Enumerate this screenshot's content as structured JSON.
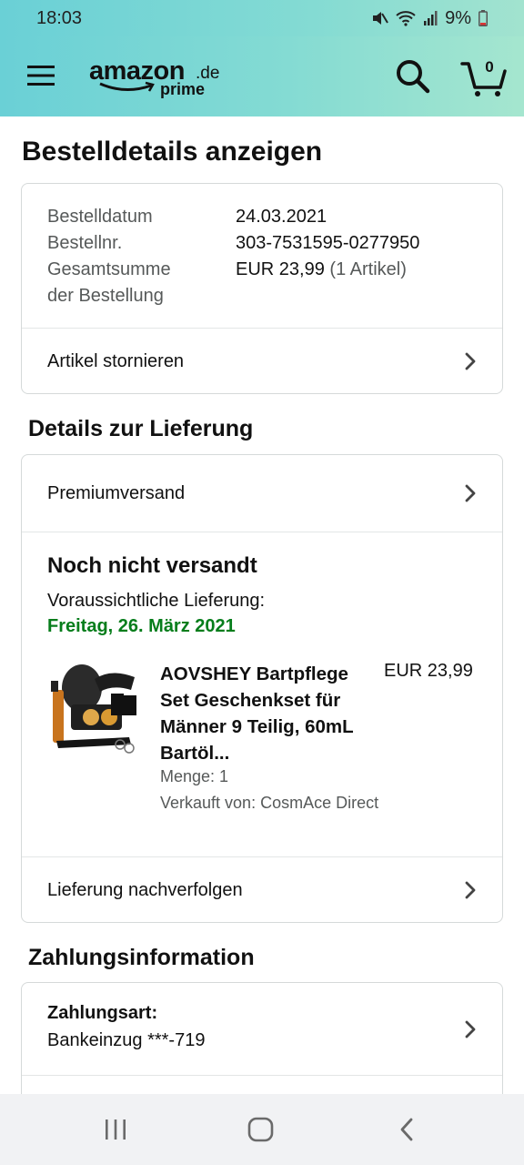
{
  "status_bar": {
    "time": "18:03",
    "battery": "9%"
  },
  "header": {
    "logo_text": "amazon",
    "logo_tld": ".de",
    "logo_sub": "prime",
    "cart_count": "0"
  },
  "page_title": "Bestelldetails anzeigen",
  "order_info": {
    "date_label": "Bestelldatum",
    "date_value": "24.03.2021",
    "number_label": "Bestellnr.",
    "number_value": "303-7531595-0277950",
    "total_label_line1": "Gesamtsumme",
    "total_label_line2": "der Bestellung",
    "total_value": "EUR 23,99",
    "total_items": "(1 Artikel)",
    "cancel_link": "Artikel stornieren"
  },
  "delivery": {
    "section_title": "Details zur Lieferung",
    "shipping_method": "Premiumversand",
    "status": "Noch nicht versandt",
    "expected_label": "Voraussichtliche Lieferung:",
    "expected_date": "Freitag, 26. März 2021",
    "product": {
      "title": "AOVSHEY Bartpflege Set Geschenkset für Männer 9 Teilig, 60mL Bartöl...",
      "price": "EUR 23,99",
      "quantity": "Menge: 1",
      "seller": "Verkauft von: CosmAce Direct"
    },
    "track_link": "Lieferung nachverfolgen"
  },
  "payment": {
    "section_title": "Zahlungsinformation",
    "method_label": "Zahlungsart:",
    "method_value": "Bankeinzug ***-719"
  },
  "colors": {
    "header_start": "#6ad0d6",
    "header_end": "#a5e6cf",
    "delivery_date": "#067d1b"
  },
  "icons": [
    "menu-icon",
    "search-icon",
    "cart-icon",
    "chevron-right-icon",
    "mute-icon",
    "wifi-icon",
    "signal-icon",
    "battery-icon"
  ]
}
